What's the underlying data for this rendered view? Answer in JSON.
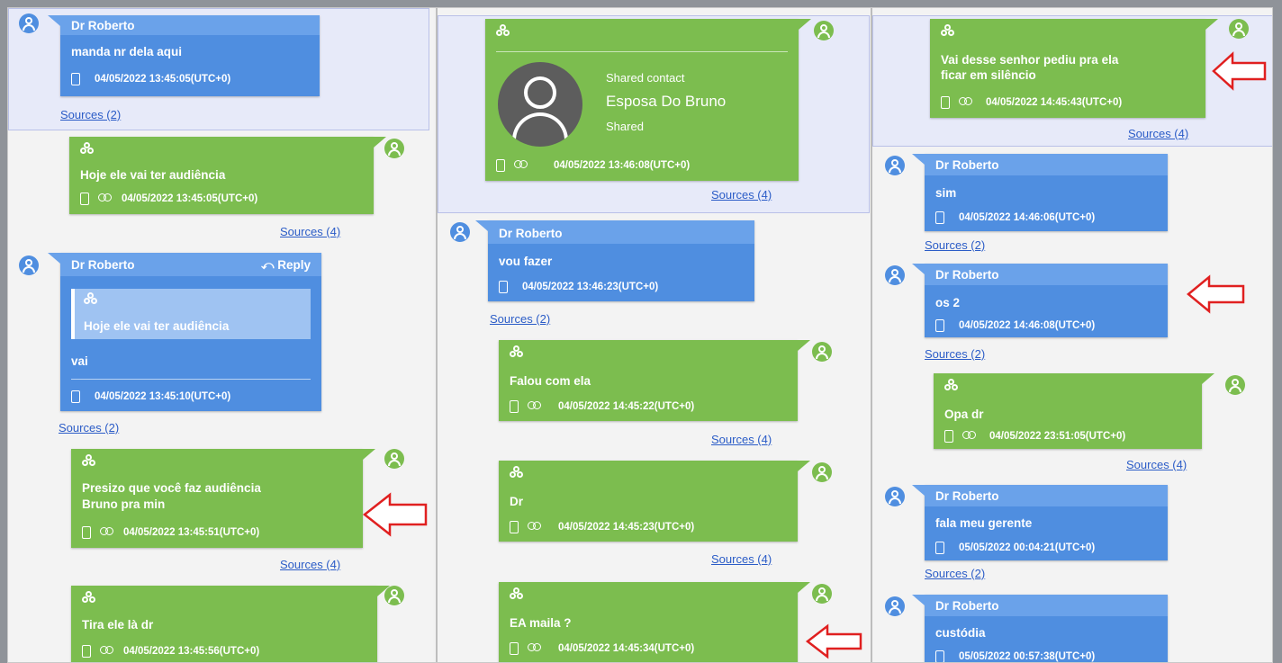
{
  "sender": "Dr Roberto",
  "reply_label": "Reply",
  "sources": {
    "s2": "Sources (2)",
    "s4": "Sources (4)"
  },
  "col1": {
    "m1": {
      "text": "manda nr dela aqui",
      "time": "04/05/2022 13:45:05(UTC+0)"
    },
    "m2": {
      "text": "Hoje ele vai ter audiência",
      "time": "04/05/2022 13:45:05(UTC+0)"
    },
    "m3": {
      "quote": "Hoje ele vai ter audiência",
      "text": "vai",
      "time": "04/05/2022 13:45:10(UTC+0)"
    },
    "m4": {
      "line1": "Presizo que você faz audiência",
      "line2": "Bruno pra min",
      "time": "04/05/2022 13:45:51(UTC+0)"
    },
    "m5": {
      "text": "Tira ele là dr",
      "time": "04/05/2022 13:45:56(UTC+0)"
    }
  },
  "col2": {
    "m1": {
      "shared_contact": "Shared contact",
      "contact_name": "Esposa Do Bruno",
      "shared": "Shared",
      "time": "04/05/2022 13:46:08(UTC+0)"
    },
    "m2": {
      "text": "vou fazer",
      "time": "04/05/2022 13:46:23(UTC+0)"
    },
    "m3": {
      "text": "Falou com ela",
      "time": "04/05/2022 14:45:22(UTC+0)"
    },
    "m4": {
      "text": "Dr",
      "time": "04/05/2022 14:45:23(UTC+0)"
    },
    "m5": {
      "text": "EA maila ?",
      "time": "04/05/2022 14:45:34(UTC+0)"
    }
  },
  "col3": {
    "m1": {
      "line1": "Vai desse senhor pediu pra ela",
      "line2": "ficar em silêncio",
      "time": "04/05/2022 14:45:43(UTC+0)"
    },
    "m2": {
      "text": "sim",
      "time": "04/05/2022 14:46:06(UTC+0)"
    },
    "m3": {
      "text": "os 2",
      "time": "04/05/2022 14:46:08(UTC+0)"
    },
    "m4": {
      "text": "Opa dr",
      "time": "04/05/2022 23:51:05(UTC+0)"
    },
    "m5": {
      "text": "fala meu gerente",
      "time": "05/05/2022 00:04:21(UTC+0)"
    },
    "m6": {
      "text": "custódia",
      "time": "05/05/2022 00:57:38(UTC+0)"
    }
  },
  "colors": {
    "incoming": "#4f8ee0",
    "outgoing": "#7cbd4f",
    "highlight": "#e7eaf9",
    "arrow": "#e02020"
  }
}
